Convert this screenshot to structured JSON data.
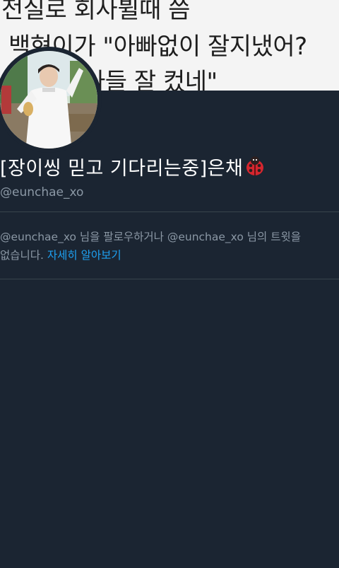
{
  "banner": {
    "line1": "전실로 회사뷜때 씀",
    "line2": "백현이가 \"아빠없이 잘지냈어?",
    "line3": "아들 잘 컸네\""
  },
  "profile": {
    "display_name": "[장이씽 믿고 기다리는중]은채",
    "handle": "@eunchae_xo"
  },
  "notice": {
    "line1": "@eunchae_xo 님을 팔로우하거나 @eunchae_xo 님의 트윗을",
    "line2_prefix": "없습니다.",
    "learn_more_link": "자세히 알아보기"
  },
  "colors": {
    "background": "#1b2532",
    "link": "#1da1f2",
    "secondary_text": "#8b98a5",
    "divider": "#38444d"
  },
  "icons": {
    "emoji": "ladybug-icon"
  }
}
